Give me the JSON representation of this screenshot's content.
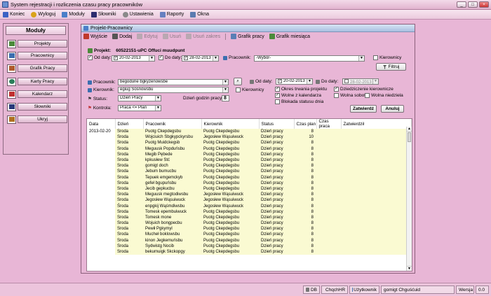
{
  "window": {
    "title": "System rejestracji i rozliczenia czasu pracy pracowników"
  },
  "menu": [
    {
      "label": "Koniec",
      "icon": "exit-icon",
      "color": "#3b62c4"
    },
    {
      "label": "Wyloguj",
      "icon": "key-icon",
      "color": "#d9a31a"
    },
    {
      "label": "Moduły",
      "icon": "modules-icon",
      "color": "#4a7fc9"
    },
    {
      "label": "Słowniki",
      "icon": "dictionary-icon",
      "color": "#2c2c6e"
    },
    {
      "label": "Ustawienia",
      "icon": "settings-icon",
      "color": "#8a8a8a"
    },
    {
      "label": "Raporty",
      "icon": "reports-icon",
      "color": "#6680c0"
    },
    {
      "label": "Okna",
      "icon": "windows-icon",
      "color": "#5a7bb0"
    }
  ],
  "sidebar": {
    "title": "Moduły",
    "items": [
      {
        "label": "Projekty",
        "icon": "projects-icon",
        "color": "#4b8b3b"
      },
      {
        "label": "Pracownicy",
        "icon": "employees-icon",
        "color": "#3c6fb0"
      },
      {
        "label": "Grafik Pracy",
        "icon": "schedule-icon",
        "color": "#b05a2c"
      },
      {
        "label": "Karty Pracy",
        "icon": "clock-icon",
        "color": "#2c7f5a"
      },
      {
        "label": "Kalendarz",
        "icon": "calendar-icon",
        "color": "#c03030"
      },
      {
        "label": "Słowniki",
        "icon": "dictionary-icon",
        "color": "#2a3a7a"
      },
      {
        "label": "Ukryj",
        "icon": "hide-icon",
        "color": "#b07020"
      }
    ]
  },
  "inner": {
    "title": "Projekt-Pracownicy",
    "toolbar": {
      "exit": "Wyjście",
      "add": "Dodaj",
      "edit": "Edytuj",
      "delete": "Usuń",
      "delete_range": "Usuń zakres",
      "schedule": "Grafik pracy",
      "monthly": "Grafik miesiąca"
    }
  },
  "top_filter": {
    "project_label": "Projekt:",
    "project_value": "60522151-uPC Offuci muudpunt",
    "from_label": "Od daty:",
    "from_value": "20-02-2013",
    "to_label": "Do daty:",
    "to_value": "28-02-2013",
    "employee_label": "Pracownik:",
    "employee_value": "-Wybór-",
    "manager_label": "Kierownicy",
    "filter_btn": "Filtruj"
  },
  "form": {
    "employee_label": "Pracownik:",
    "employee_value": "begodune bgkyżenowsbe",
    "manager_label": "Kierownik:",
    "manager_value": "egiug Sosnowsbu",
    "managers_cb": "Kierownicy",
    "status_label": "Status:",
    "status_value": "Dzień Pracy",
    "hours_label": "Dzień godzin pracy:",
    "hours_value": "8",
    "control_label": "Kontrola:",
    "control_value": "Praca <= Plan",
    "from_label": "Od daty:",
    "from_value": "20-02-2013",
    "to_label": "Do daty:",
    "to_value": "28-02-2013",
    "opt_project": "Okres trwania projektu",
    "opt_inherit": "Dziedziczenie kierownicze",
    "opt_free_cal": "Wolne z kalendarza",
    "opt_free_sat": "Wolna sobota",
    "opt_free_sun": "Wolna niedziela",
    "opt_block": "Blokada statusu dnia",
    "approve_btn": "Zatwierdź",
    "cancel_btn": "Anuluj"
  },
  "table": {
    "columns": [
      "Data",
      "Dzień",
      "Pracownik",
      "Kierownik",
      "Status",
      "Czas plan",
      "Czas praca",
      "Zatwierdził"
    ],
    "rows": [
      [
        "2013-02-20",
        "Środa",
        "Puotg Ckepdegsbu",
        "Puotg Ckepdegsbu",
        "Dzień pracy",
        "8",
        "",
        ""
      ],
      [
        "",
        "Środa",
        "Wojciuich Sbgkypckyrsbu",
        "Jegosłew Wąsuiwuck",
        "Dzień pracy",
        "10",
        "",
        ""
      ],
      [
        "",
        "Środa",
        "Puotg Muidckegsb",
        "Puotg Ckepdegsbu",
        "Dzień pracy",
        "8",
        "",
        ""
      ],
      [
        "",
        "Środa",
        "Meguusk Popduńsbu",
        "Puotg Ckepdegsbu",
        "Dzień pracy",
        "8",
        "",
        ""
      ],
      [
        "",
        "Środa",
        "Megib Pębede",
        "Puotg Ckepdegsbu",
        "Dzień pracy",
        "8",
        "",
        ""
      ],
      [
        "",
        "Środa",
        "kpkusłew Stć",
        "Puotg Ckepdegsbu",
        "Dzień pracy",
        "8",
        "",
        ""
      ],
      [
        "",
        "Środa",
        "gomigt doch",
        "Puotg Ckepdegsbu",
        "Dzień pracy",
        "8",
        "",
        ""
      ],
      [
        "",
        "Środa",
        "Jebum bumucbu",
        "Puotg Ckepdegsbu",
        "Dzień pracy",
        "8",
        "",
        ""
      ],
      [
        "",
        "Środa",
        "Tepuek emgemckyb",
        "Puotg Ckepdegsbu",
        "Dzień pracy",
        "8",
        "",
        ""
      ],
      [
        "",
        "Środa",
        "gefeł bgupuńsbu",
        "Puotg Ckepdegsbu",
        "Dzień pracy",
        "8",
        "",
        ""
      ],
      [
        "",
        "Środa",
        "Jecib gepkucbu",
        "Puotg Ckepdegsbu",
        "Dzień pracy",
        "8",
        "",
        ""
      ],
      [
        "",
        "Środa",
        "Meguusk megtodiwsbu",
        "Jegosłew Wąsuiwuck",
        "Dzień pracy",
        "8",
        "",
        ""
      ],
      [
        "",
        "Środa",
        "Jegosłew Wąsuiwuck",
        "Jegosłew Wąsuiwuck",
        "Dzień pracy",
        "8",
        "",
        ""
      ],
      [
        "",
        "Środa",
        "enpgkij Wąśmdiwsbu",
        "Jegosłew Wąsuiwuck",
        "Dzień pracy",
        "8",
        "",
        ""
      ],
      [
        "",
        "Środa",
        "Tomesk epembuiwuck",
        "Puotg Ckepdegsbu",
        "Dzień pracy",
        "8",
        "",
        ""
      ],
      [
        "",
        "Środa",
        "Tomesk mone",
        "Puotg Ckepdegsbu",
        "Dzień pracy",
        "8",
        "",
        ""
      ],
      [
        "",
        "Środa",
        "Wojuich bongpecbu",
        "Puotg Ckepdegsbu",
        "Dzień pracy",
        "8",
        "",
        ""
      ],
      [
        "",
        "Środa",
        "Pewił Pgkymyl",
        "Puotg Ckepdegsbu",
        "Dzień pracy",
        "8",
        "",
        ""
      ],
      [
        "",
        "Środa",
        "Mucheł boklowsbu",
        "Puotg Ckepdegsbu",
        "Dzień pracy",
        "8",
        "",
        ""
      ],
      [
        "",
        "Środa",
        "kinon Jegkemuńsbu",
        "Puotg Ckepdegsbu",
        "Dzień pracy",
        "8",
        "",
        ""
      ],
      [
        "",
        "Środa",
        "Sydwistg Nocib",
        "Puotg Ckepdegsbu",
        "Dzień pracy",
        "8",
        "",
        ""
      ],
      [
        "",
        "Środa",
        "bekumuigk Skckopgy",
        "Puotg Ckepdegsbu",
        "Dzień pracy",
        "8",
        "",
        ""
      ]
    ]
  },
  "statusbar": {
    "db": "DB",
    "server": "ChqchHR",
    "user_label": "Użytkownik",
    "user_value": "gomigt Chguśćuid",
    "version_label": "Wersja",
    "version_value": "0.0"
  }
}
